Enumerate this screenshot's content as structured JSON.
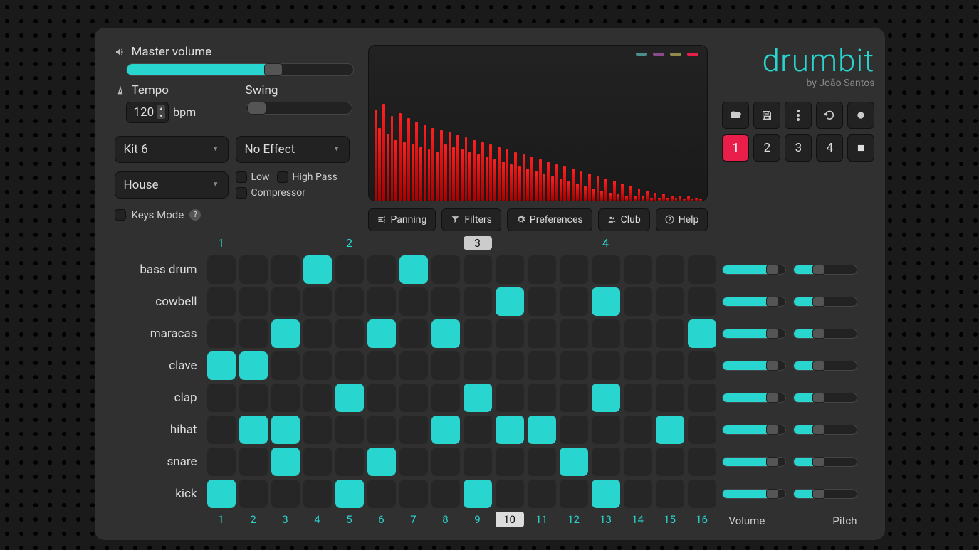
{
  "master_volume_label": "Master volume",
  "master_volume": 65,
  "tempo_label": "Tempo",
  "tempo_value": "120",
  "bpm_label": "bpm",
  "swing_label": "Swing",
  "swing_value": 0,
  "kit_select": "Kit 6",
  "effect_select": "No Effect",
  "genre_select": "House",
  "checkbox_low": "Low",
  "checkbox_highpass": "High Pass",
  "checkbox_compressor": "Compressor",
  "keys_mode_label": "Keys Mode",
  "logo": "drumbit",
  "byline": "by João Santos",
  "tabs": {
    "panning": "Panning",
    "filters": "Filters",
    "preferences": "Preferences",
    "club": "Club",
    "help": "Help"
  },
  "patterns": [
    "1",
    "2",
    "3",
    "4"
  ],
  "active_pattern": 0,
  "beat_groups": [
    "1",
    "2",
    "3",
    "4"
  ],
  "current_group": 2,
  "steps": [
    "1",
    "2",
    "3",
    "4",
    "5",
    "6",
    "7",
    "8",
    "9",
    "10",
    "11",
    "12",
    "13",
    "14",
    "15",
    "16"
  ],
  "current_step": 9,
  "tracks": [
    {
      "name": "bass drum",
      "cells": [
        0,
        0,
        0,
        1,
        0,
        0,
        1,
        0,
        0,
        0,
        0,
        0,
        0,
        0,
        0,
        0
      ],
      "vol": 80,
      "pitch": 40
    },
    {
      "name": "cowbell",
      "cells": [
        0,
        0,
        0,
        0,
        0,
        0,
        0,
        0,
        0,
        1,
        0,
        0,
        1,
        0,
        0,
        0
      ],
      "vol": 80,
      "pitch": 40
    },
    {
      "name": "maracas",
      "cells": [
        0,
        0,
        1,
        0,
        0,
        1,
        0,
        1,
        0,
        0,
        0,
        0,
        0,
        0,
        0,
        1
      ],
      "vol": 80,
      "pitch": 40
    },
    {
      "name": "clave",
      "cells": [
        1,
        1,
        0,
        0,
        0,
        0,
        0,
        0,
        0,
        0,
        0,
        0,
        0,
        0,
        0,
        0
      ],
      "vol": 80,
      "pitch": 40
    },
    {
      "name": "clap",
      "cells": [
        0,
        0,
        0,
        0,
        1,
        0,
        0,
        0,
        1,
        0,
        0,
        0,
        1,
        0,
        0,
        0
      ],
      "vol": 80,
      "pitch": 40
    },
    {
      "name": "hihat",
      "cells": [
        0,
        1,
        1,
        0,
        0,
        0,
        0,
        1,
        0,
        1,
        1,
        0,
        0,
        0,
        1,
        0
      ],
      "vol": 80,
      "pitch": 40
    },
    {
      "name": "snare",
      "cells": [
        0,
        0,
        1,
        0,
        0,
        1,
        0,
        0,
        0,
        0,
        0,
        1,
        0,
        0,
        0,
        0
      ],
      "vol": 80,
      "pitch": 40
    },
    {
      "name": "kick",
      "cells": [
        1,
        0,
        0,
        0,
        1,
        0,
        0,
        0,
        1,
        0,
        0,
        0,
        1,
        0,
        0,
        0
      ],
      "vol": 80,
      "pitch": 40
    }
  ],
  "slider_col_vol": "Volume",
  "slider_col_pitch": "Pitch",
  "viz_heights": [
    75,
    60,
    80,
    55,
    70,
    50,
    72,
    48,
    68,
    46,
    65,
    44,
    62,
    42,
    60,
    40,
    58,
    46,
    56,
    44,
    54,
    42,
    52,
    40,
    50,
    38,
    48,
    36,
    46,
    34,
    44,
    32,
    42,
    30,
    40,
    28,
    38,
    26,
    36,
    24,
    34,
    22,
    32,
    20,
    30,
    18,
    28,
    16,
    26,
    14,
    24,
    12,
    22,
    10,
    20,
    8,
    18,
    6,
    16,
    5,
    14,
    4,
    12,
    3,
    10,
    3,
    8,
    2,
    6,
    2,
    5,
    2,
    4,
    2,
    3,
    1,
    3,
    1,
    2,
    1
  ]
}
